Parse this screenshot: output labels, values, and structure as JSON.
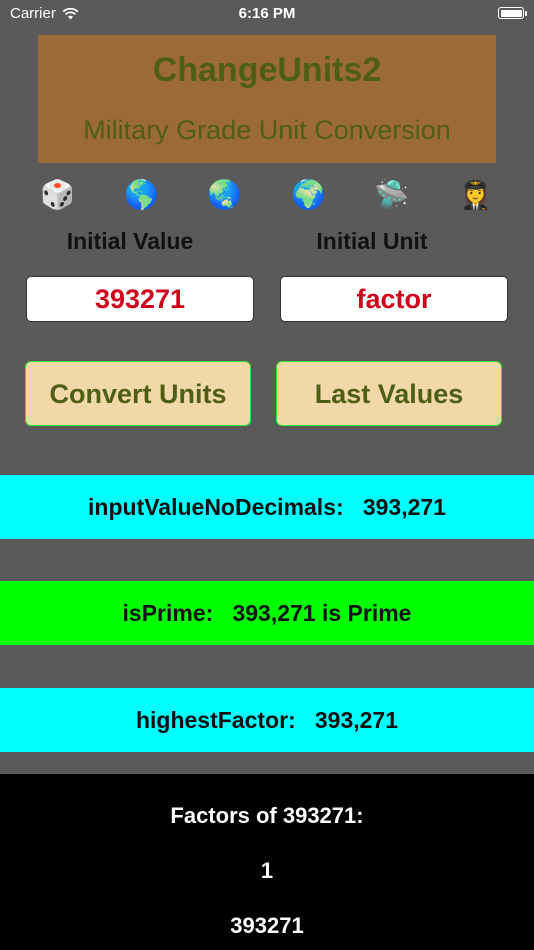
{
  "status_bar": {
    "carrier": "Carrier",
    "time": "6:16 PM"
  },
  "banner": {
    "title": "ChangeUnits2",
    "subtitle": "Military Grade Unit Conversion",
    "background": "#9c6a34",
    "text_color": "#4f5e17"
  },
  "icons": [
    {
      "name": "dice-icon",
      "glyph": "🎲"
    },
    {
      "name": "globe-americas-icon",
      "glyph": "🌎"
    },
    {
      "name": "globe-asia-icon",
      "glyph": "🌏"
    },
    {
      "name": "globe-europe-africa-icon",
      "glyph": "🌍"
    },
    {
      "name": "flying-saucer-icon",
      "glyph": "🛸"
    },
    {
      "name": "woman-pilot-icon",
      "glyph": "👩‍✈️"
    }
  ],
  "form": {
    "initial_value_label": "Initial Value",
    "initial_unit_label": "Initial Unit",
    "initial_value": "393271",
    "initial_unit": "factor"
  },
  "buttons": {
    "convert": "Convert Units",
    "last_values": "Last Values"
  },
  "results": [
    {
      "text": "inputValueNoDecimals:   393,271",
      "color": "#00ffff"
    },
    {
      "text": "isPrime:   393,271 is Prime",
      "color": "#00ff00"
    },
    {
      "text": "highestFactor:   393,271",
      "color": "#00ffff"
    }
  ],
  "factors": {
    "heading": "Factors of 393271:",
    "values": [
      "1",
      "393271"
    ]
  }
}
